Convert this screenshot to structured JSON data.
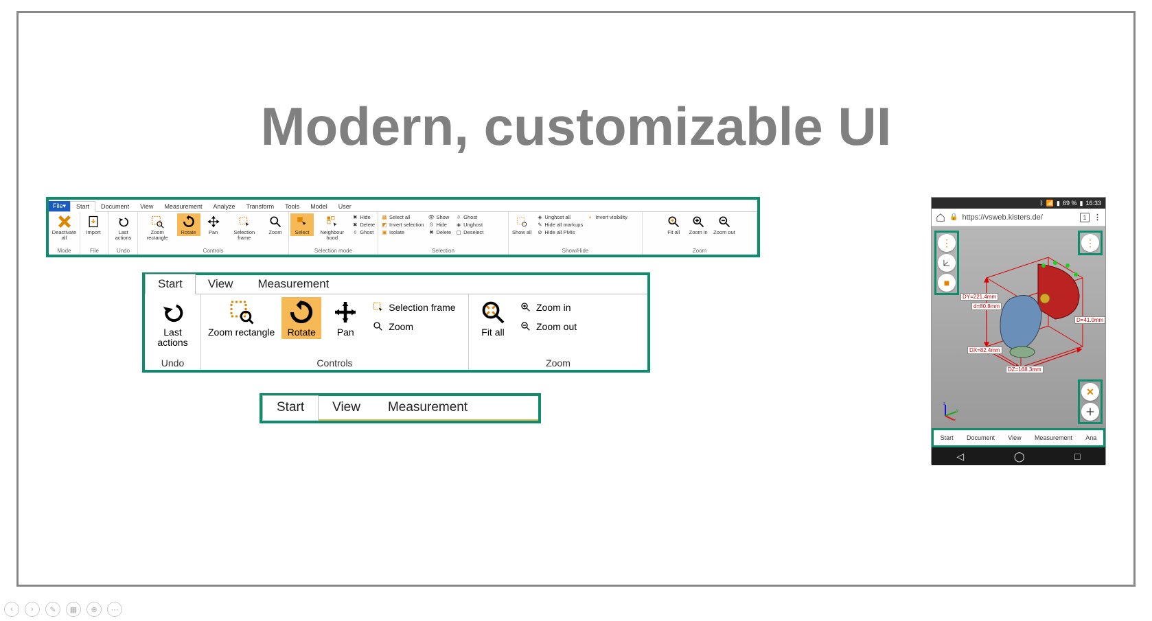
{
  "title": "Modern, customizable UI",
  "ribbon1": {
    "file_tab": "File▾",
    "tabs": [
      "Start",
      "Document",
      "View",
      "Measurement",
      "Analyze",
      "Transform",
      "Tools",
      "Model",
      "User"
    ],
    "mode": {
      "label": "Mode",
      "btn": "Deactivate all"
    },
    "file": {
      "label": "File",
      "btn": "Import"
    },
    "undo": {
      "label": "Undo",
      "btn": "Last actions"
    },
    "controls": {
      "label": "Controls",
      "zoom_rect": "Zoom rectangle",
      "rotate": "Rotate",
      "pan": "Pan",
      "sel_frame": "Selection frame",
      "zoom": "Zoom"
    },
    "selmode": {
      "label": "Selection mode",
      "select": "Select",
      "neighbour": "Neighbour hood",
      "hide": "Hide",
      "delete": "Delete",
      "ghost": "Ghost"
    },
    "selection": {
      "label": "Selection",
      "select_all": "Select all",
      "invert_sel": "Invert selection",
      "isolate": "Isolate",
      "show": "Show",
      "hide": "Hide",
      "delete": "Delete",
      "ghost": "Ghost",
      "unghost": "Unghost",
      "deselect": "Deselect"
    },
    "showhide": {
      "label": "Show/Hide",
      "show_all": "Show all",
      "unghost_all": "Unghost all",
      "hide_markups": "Hide all markups",
      "hide_pmis": "Hide all PMIs",
      "invert_vis": "Invert visibility"
    },
    "zoom": {
      "label": "Zoom",
      "fit_all": "Fit all",
      "zoom_in": "Zoom in",
      "zoom_out": "Zoom out"
    }
  },
  "ribbon2": {
    "tabs": [
      "Start",
      "View",
      "Measurement"
    ],
    "undo": {
      "label": "Undo",
      "btn": "Last actions"
    },
    "controls": {
      "label": "Controls",
      "zoom_rect": "Zoom rectangle",
      "rotate": "Rotate",
      "pan": "Pan",
      "sel_frame": "Selection frame",
      "zoom": "Zoom"
    },
    "zoom": {
      "label": "Zoom",
      "fit_all": "Fit all",
      "zoom_in": "Zoom in",
      "zoom_out": "Zoom out"
    }
  },
  "ribbon3": {
    "tabs": [
      "Start",
      "View",
      "Measurement"
    ]
  },
  "mobile": {
    "status": {
      "battery": "69 %",
      "time": "16:33"
    },
    "url": "https://vsweb.kisters.de/",
    "tab_count": "1",
    "measurements": {
      "dy": "DY=221.4mm",
      "d": "d=80.8mm",
      "dx": "DX=82.4mm",
      "dz": "DZ=168.3mm",
      "D": "D=41.0mm"
    },
    "tabs": [
      "Start",
      "Document",
      "View",
      "Measurement",
      "Ana"
    ]
  }
}
